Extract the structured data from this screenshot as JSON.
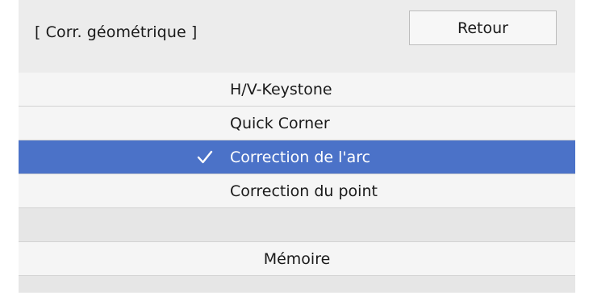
{
  "header": {
    "title": "[ Corr. géométrique ]",
    "back_label": "Retour"
  },
  "menu": {
    "items": [
      {
        "label": "H/V-Keystone",
        "selected": false
      },
      {
        "label": "Quick Corner",
        "selected": false
      },
      {
        "label": "Correction de l'arc",
        "selected": true
      },
      {
        "label": "Correction du point",
        "selected": false
      }
    ],
    "memory_label": "Mémoire"
  },
  "colors": {
    "selected_background": "#4b72c8",
    "panel_background": "#ececec"
  },
  "icons": {
    "selected_marker": "checkmark-icon"
  }
}
